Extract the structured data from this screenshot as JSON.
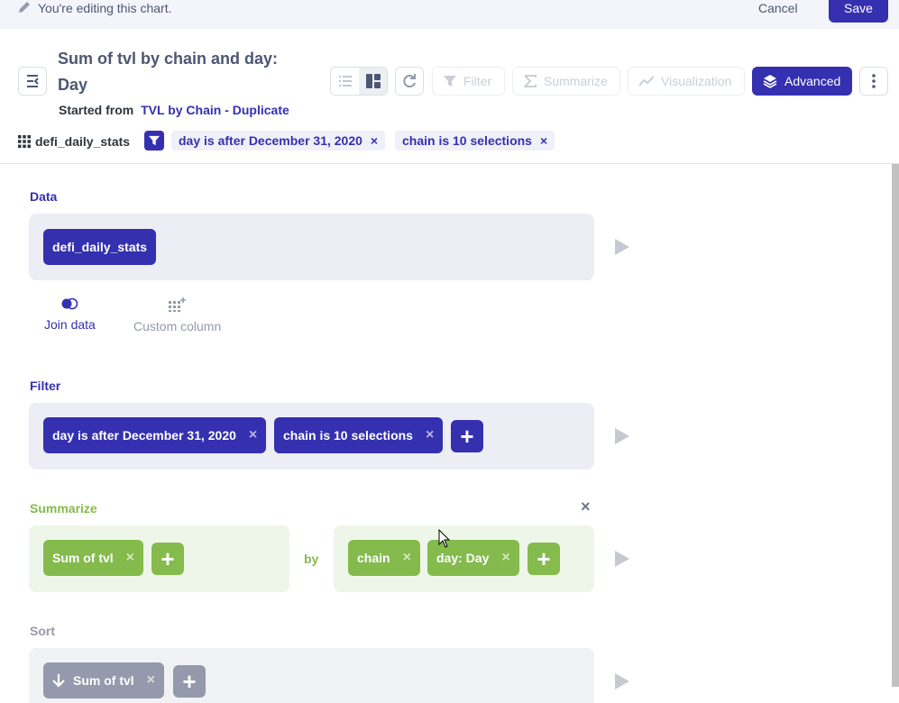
{
  "edit_bar": {
    "message": "You're editing this chart.",
    "cancel_label": "Cancel",
    "save_label": "Save"
  },
  "header": {
    "title": "Sum of tvl by chain and day: Day",
    "started_from_label": "Started from",
    "started_from_link": "TVL by Chain - Duplicate",
    "buttons": {
      "filter": "Filter",
      "summarize": "Summarize",
      "visualization": "Visualization",
      "advanced": "Advanced"
    }
  },
  "source": {
    "table_name": "defi_daily_stats",
    "filters": [
      "day is after December 31, 2020",
      "chain is 10 selections"
    ]
  },
  "notebook": {
    "data": {
      "label": "Data",
      "table": "defi_daily_stats",
      "actions": {
        "join": "Join data",
        "custom_column": "Custom column"
      }
    },
    "filter": {
      "label": "Filter",
      "items": [
        "day is after December 31, 2020",
        "chain is 10 selections"
      ]
    },
    "summarize": {
      "label": "Summarize",
      "metrics": [
        "Sum of tvl"
      ],
      "by_label": "by",
      "breakouts": [
        "chain",
        "day: Day"
      ]
    },
    "sort": {
      "label": "Sort",
      "items": [
        "Sum of tvl"
      ]
    }
  },
  "icons": {
    "close": "×",
    "add": "+"
  },
  "colors": {
    "brand": "#3430b0",
    "summarize": "#84bb4c",
    "sort": "#949aab"
  }
}
